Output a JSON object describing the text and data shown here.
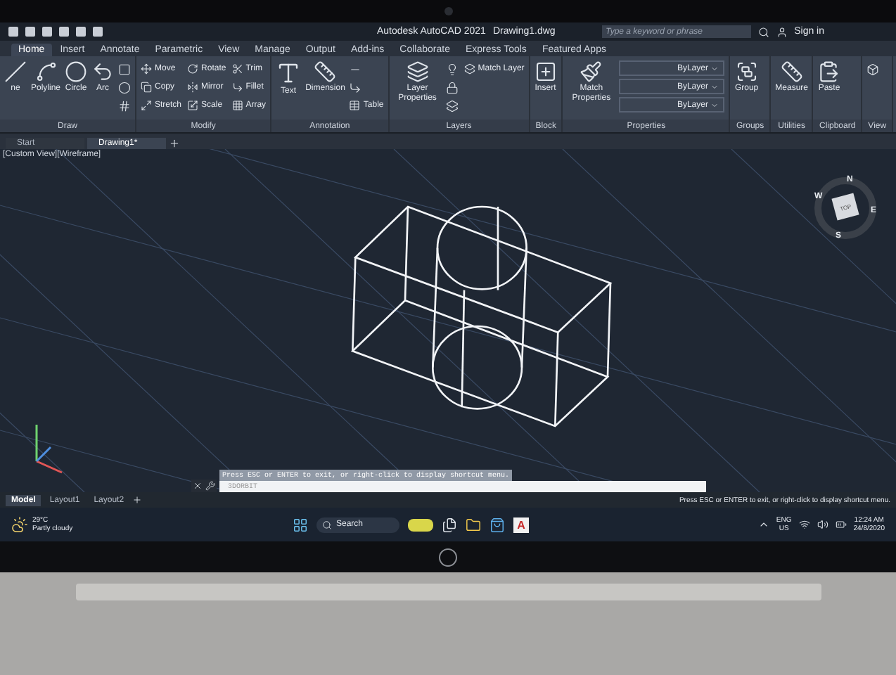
{
  "window": {
    "app_title": "Autodesk AutoCAD 2021",
    "file_title": "Drawing1.dwg",
    "search": {
      "placeholder": "Type a keyword or phrase"
    },
    "sign_in": "Sign in"
  },
  "ribbon_tabs": [
    {
      "label": "Home",
      "selected": true
    },
    {
      "label": "Insert",
      "selected": false
    },
    {
      "label": "Annotate",
      "selected": false
    },
    {
      "label": "Parametric",
      "selected": false
    },
    {
      "label": "View",
      "selected": false
    },
    {
      "label": "Manage",
      "selected": false
    },
    {
      "label": "Output",
      "selected": false
    },
    {
      "label": "Add-ins",
      "selected": false
    },
    {
      "label": "Collaborate",
      "selected": false
    },
    {
      "label": "Express Tools",
      "selected": false
    },
    {
      "label": "Featured Apps",
      "selected": false
    }
  ],
  "ribbon_panels": [
    {
      "title": "Draw",
      "tools": [
        {
          "kind": "large",
          "label": "ne"
        },
        {
          "kind": "large",
          "label": "Polyline"
        },
        {
          "kind": "large",
          "label": "Circle"
        },
        {
          "kind": "large",
          "label": "Arc"
        },
        {
          "kind": "icon"
        },
        {
          "kind": "icon"
        },
        {
          "kind": "icon"
        }
      ]
    },
    {
      "title": "Modify",
      "tools": [
        {
          "kind": "small",
          "label": "Move"
        },
        {
          "kind": "small",
          "label": "Copy"
        },
        {
          "kind": "small",
          "label": "Stretch"
        },
        {
          "kind": "small",
          "label": "Rotate"
        },
        {
          "kind": "small",
          "label": "Mirror"
        },
        {
          "kind": "small",
          "label": "Scale"
        },
        {
          "kind": "small",
          "label": "Trim"
        },
        {
          "kind": "small",
          "label": "Fillet"
        },
        {
          "kind": "small",
          "label": "Array"
        }
      ]
    },
    {
      "title": "Annotation",
      "tools": [
        {
          "kind": "large",
          "label": "Text"
        },
        {
          "kind": "large",
          "label": "Dimension"
        },
        {
          "kind": "icon"
        },
        {
          "kind": "icon"
        },
        {
          "kind": "small",
          "label": "Table"
        }
      ]
    },
    {
      "title": "Layers",
      "tools": [
        {
          "kind": "large",
          "label": "Layer Properties"
        },
        {
          "kind": "icon"
        },
        {
          "kind": "icon"
        },
        {
          "kind": "icon"
        },
        {
          "kind": "small",
          "label": "Match Layer"
        }
      ]
    },
    {
      "title": "Block",
      "tools": [
        {
          "kind": "large",
          "label": "Insert"
        }
      ]
    },
    {
      "title": "Properties",
      "tools": [
        {
          "kind": "large",
          "label": "Match Properties"
        },
        {
          "kind": "combo",
          "label": "ByLayer"
        },
        {
          "kind": "combo",
          "label": "ByLayer"
        },
        {
          "kind": "combo",
          "label": "ByLayer"
        }
      ]
    },
    {
      "title": "Groups",
      "tools": [
        {
          "kind": "large",
          "label": "Group"
        }
      ]
    },
    {
      "title": "Utilities",
      "tools": [
        {
          "kind": "large",
          "label": "Measure"
        }
      ]
    },
    {
      "title": "Clipboard",
      "tools": [
        {
          "kind": "large",
          "label": "Paste"
        }
      ]
    },
    {
      "title": "View",
      "tools": [
        {
          "kind": "icon"
        }
      ]
    }
  ],
  "file_tabs": [
    {
      "label": "Start",
      "selected": false
    },
    {
      "label": "Drawing1*",
      "selected": true
    }
  ],
  "viewport": {
    "label": "[Custom View][Wireframe]",
    "view_cube": {
      "face": "TOP",
      "north": "N",
      "east": "E",
      "south": "S",
      "west": "W"
    }
  },
  "command_line": {
    "message": "Press ESC or ENTER to exit, or right-click to display shortcut menu.",
    "input": "3DORBIT"
  },
  "layout_tabs": [
    {
      "label": "Model",
      "selected": true
    },
    {
      "label": "Layout1",
      "selected": false
    },
    {
      "label": "Layout2",
      "selected": false
    }
  ],
  "status_message": "Press ESC or ENTER to exit, or right-click to display shortcut menu.",
  "taskbar": {
    "temperature": "29°C",
    "weather": "Partly cloudy",
    "search": "Search",
    "app_letter": "A",
    "language": "ENG",
    "region": "US",
    "time": "12:24 AM",
    "date": "24/8/2020"
  }
}
